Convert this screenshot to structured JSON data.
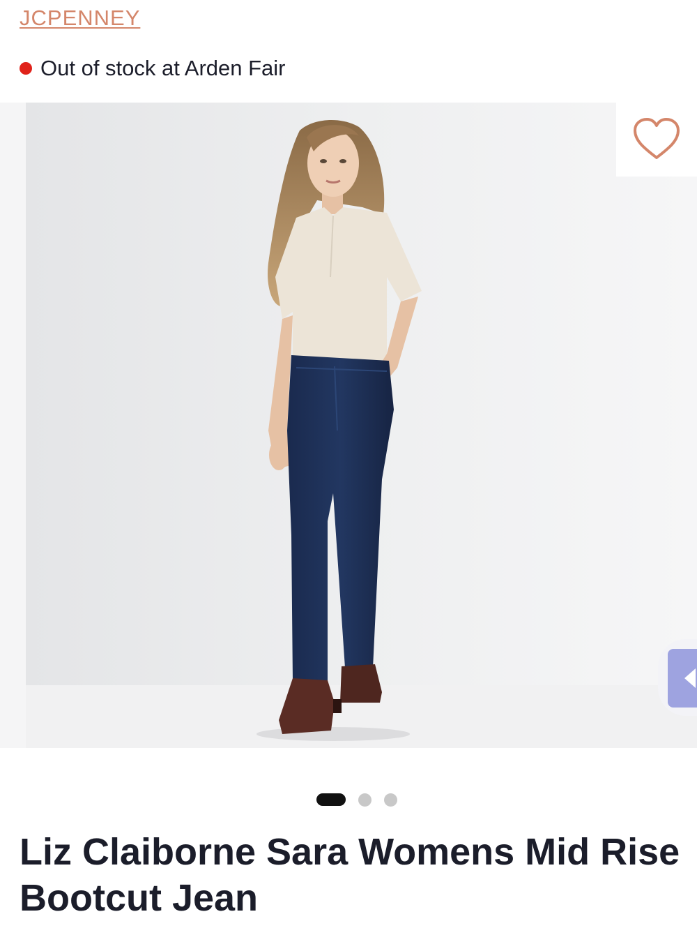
{
  "brand": {
    "label": "JCPENNEY"
  },
  "availability": {
    "status_text": "Out of stock at Arden Fair",
    "status_color": "#e0221a"
  },
  "gallery": {
    "current_index": 1,
    "total_images": 3,
    "image_alt": "Model wearing bootcut jeans with a cream short-sleeve top and brown ankle boots"
  },
  "wishlist": {
    "icon": "heart-outline-icon",
    "color": "#d4866a"
  },
  "side_widget": {
    "icon": "chevron-left-icon",
    "color": "#9ea3e0"
  },
  "product": {
    "title": "Liz Claiborne Sara Womens Mid Rise Bootcut Jean"
  },
  "colors": {
    "accent": "#d4866a",
    "text": "#1b1d2a"
  }
}
